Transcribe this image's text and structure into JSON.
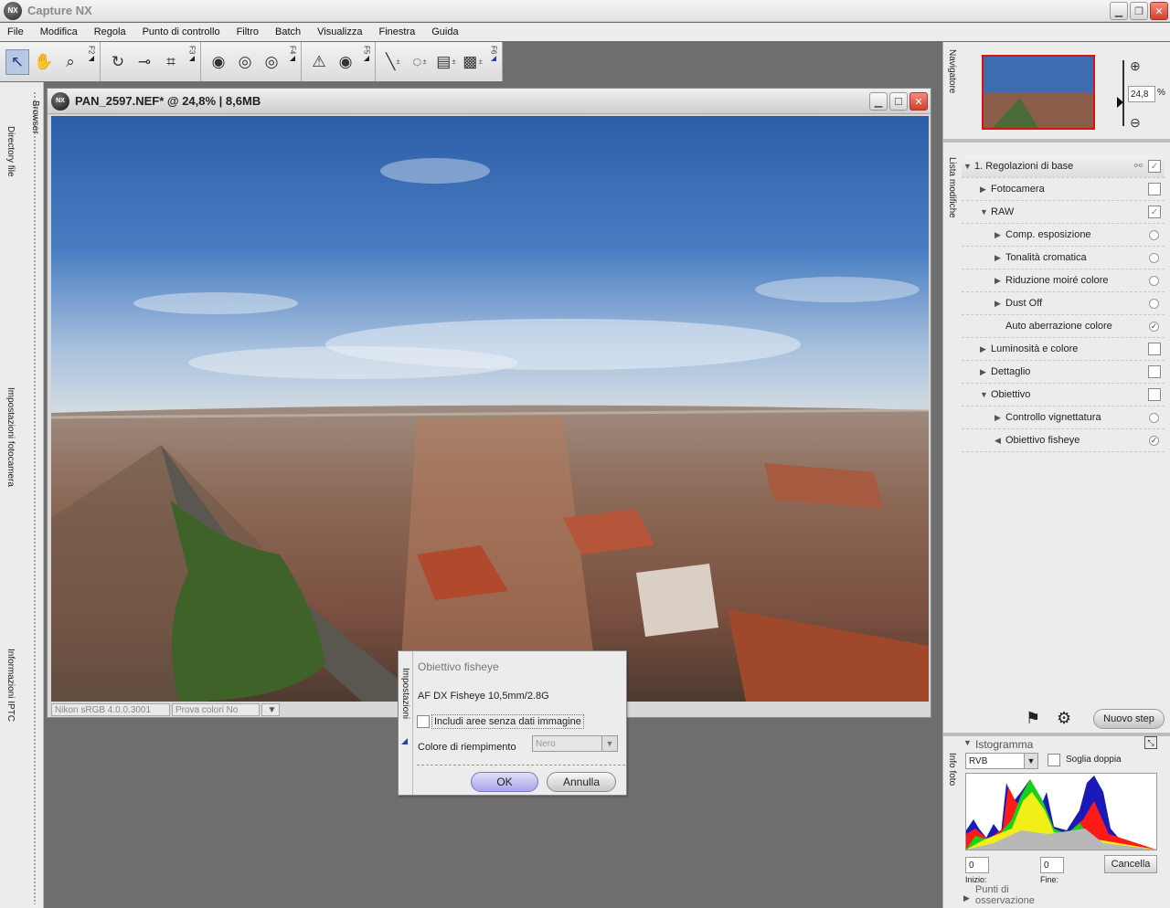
{
  "app": {
    "title": "Capture NX",
    "logo_text": "NX"
  },
  "menu": [
    "File",
    "Modifica",
    "Regola",
    "Punto di controllo",
    "Filtro",
    "Batch",
    "Visualizza",
    "Finestra",
    "Guida"
  ],
  "toolbar": {
    "groups": [
      {
        "fkey": "F2",
        "tools": [
          "select-arrow-icon",
          "hand-icon",
          "zoom-icon"
        ]
      },
      {
        "fkey": "F3",
        "tools": [
          "rotate-icon",
          "straighten-icon",
          "crop-icon"
        ]
      },
      {
        "fkey": "F4",
        "tools": [
          "black-point-icon",
          "white-point-icon",
          "neutral-point-icon"
        ]
      },
      {
        "fkey": "F5",
        "tools": [
          "red-eye-icon",
          "eye-icon"
        ]
      },
      {
        "fkey": "F6",
        "tools": [
          "brush-icon",
          "lasso-icon",
          "gradient-icon",
          "fill-icon"
        ]
      }
    ]
  },
  "left_dock": {
    "browser": "Browser",
    "directory": "Directory file",
    "camera_settings": "Impostazioni fotocamera",
    "iptc": "Informazioni IPTC"
  },
  "document": {
    "title": "PAN_2597.NEF* @ 24,8% | 8,6MB",
    "profile": "Nikon sRGB 4.0.0.3001",
    "proof": "Prova colori No"
  },
  "navigator": {
    "label": "Navigatore",
    "zoom_value": "24,8",
    "zoom_unit": "%"
  },
  "edit_list": {
    "label": "Lista modifiche",
    "rows": [
      {
        "label": "1. Regolazioni di base",
        "level": 0,
        "tri": "down",
        "control": "check",
        "checked": true,
        "head": true
      },
      {
        "label": "Fotocamera",
        "level": 1,
        "tri": "right",
        "control": "check",
        "checked": false
      },
      {
        "label": "RAW",
        "level": 1,
        "tri": "down",
        "control": "check",
        "checked": true
      },
      {
        "label": "Comp. esposizione",
        "level": 2,
        "tri": "right",
        "control": "radio",
        "checked": false
      },
      {
        "label": "Tonalità cromatica",
        "level": 2,
        "tri": "right",
        "control": "radio",
        "checked": false
      },
      {
        "label": "Riduzione moiré colore",
        "level": 2,
        "tri": "right",
        "control": "radio",
        "checked": false
      },
      {
        "label": "Dust Off",
        "level": 2,
        "tri": "right",
        "control": "radio",
        "checked": false
      },
      {
        "label": "Auto aberrazione colore",
        "level": 2,
        "tri": "none",
        "control": "radio",
        "checked": true
      },
      {
        "label": "Luminosità e colore",
        "level": 1,
        "tri": "right",
        "control": "check",
        "checked": false
      },
      {
        "label": "Dettaglio",
        "level": 1,
        "tri": "right",
        "control": "check",
        "checked": false
      },
      {
        "label": "Obiettivo",
        "level": 1,
        "tri": "down",
        "control": "check",
        "checked": false
      },
      {
        "label": "Controllo vignettatura",
        "level": 2,
        "tri": "right",
        "control": "radio",
        "checked": false
      },
      {
        "label": "Obiettivo fisheye",
        "level": 2,
        "tri": "left",
        "control": "radio",
        "checked": true
      }
    ],
    "new_step": "Nuovo step"
  },
  "info": {
    "label": "Info foto",
    "histogram_label": "Istogramma",
    "channel": "RVB",
    "double_threshold": "Soglia doppia",
    "start_value": "0",
    "end_value": "0",
    "start_label": "Inizio:",
    "end_label": "Fine:",
    "cancel": "Cancella",
    "watch_points": "Punti di osservazione"
  },
  "dialog": {
    "side_label": "Impostazioni",
    "title": "Obiettivo fisheye",
    "lens": "AF DX Fisheye 10,5mm/2.8G",
    "include_label": "Includi aree senza dati immagine",
    "include_checked": false,
    "fill_label": "Colore di riempimento",
    "fill_value": "Nero",
    "ok": "OK",
    "cancel": "Annulla"
  }
}
